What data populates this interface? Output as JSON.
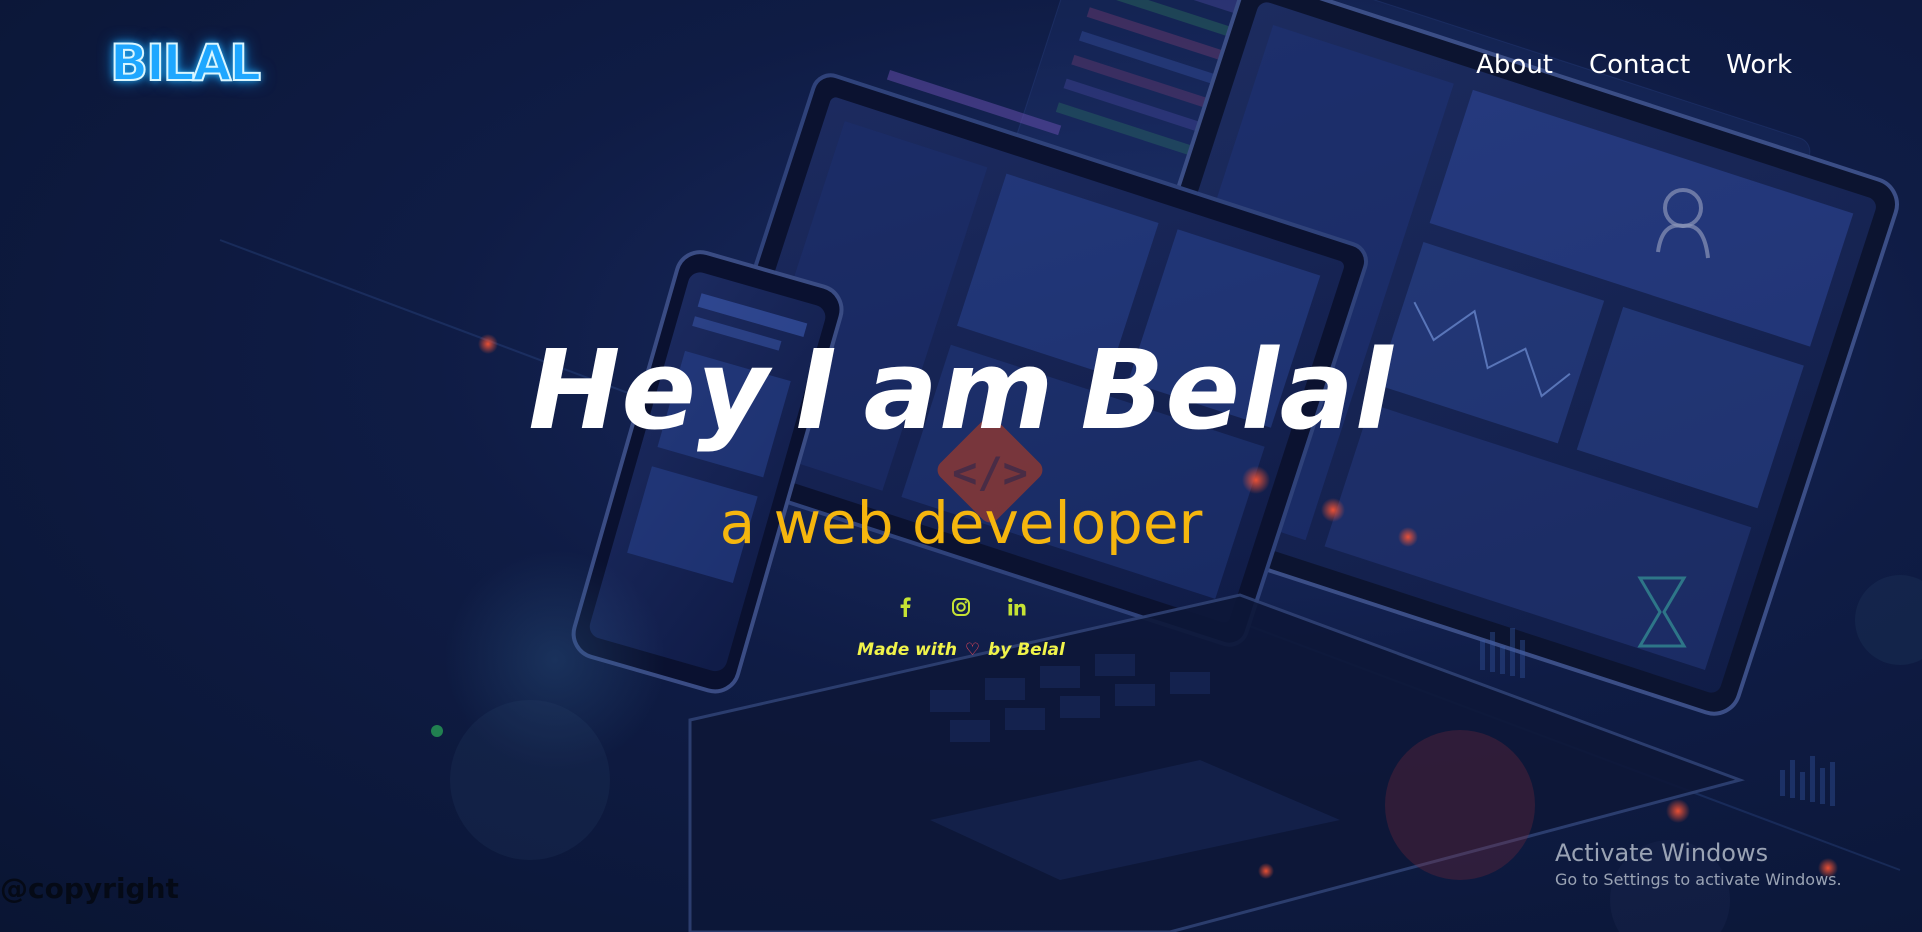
{
  "logo": {
    "text": "BILAL"
  },
  "nav": {
    "items": [
      {
        "label": "About"
      },
      {
        "label": "Contact"
      },
      {
        "label": "Work"
      }
    ]
  },
  "hero": {
    "greeting_1": "Hey",
    "greeting_2": "I",
    "greeting_3": "am",
    "name": "Belal",
    "subtitle": "a web developer",
    "socials": [
      {
        "icon": "facebook-icon"
      },
      {
        "icon": "instagram-icon"
      },
      {
        "icon": "linkedin-icon"
      }
    ],
    "made_with_prefix": "Made with",
    "made_with_heart": "♡",
    "made_with_suffix": "by Belal"
  },
  "footer": {
    "copyright": "@copyright"
  },
  "os_overlay": {
    "title": "Activate Windows",
    "subtitle": "Go to Settings to activate Windows."
  },
  "colors": {
    "background": "#0f1c45",
    "accent_yellow": "#f5b60e",
    "icon_green": "#c6e334",
    "heart_red": "#ff4b5c",
    "logo_blue": "#1ea7ff"
  }
}
